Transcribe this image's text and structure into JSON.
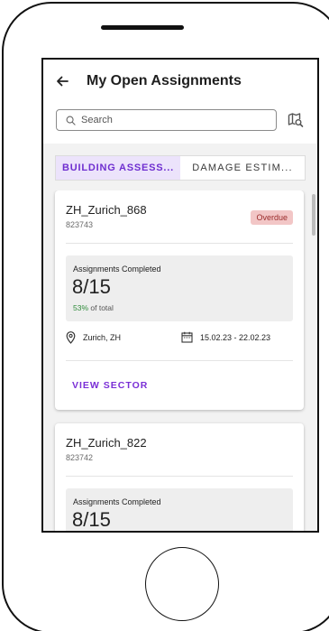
{
  "header": {
    "back_icon": "arrow-left-icon",
    "title": "My Open Assignments"
  },
  "search": {
    "placeholder": "Search",
    "icon": "search-icon",
    "map_icon": "map-search-icon"
  },
  "tabs": [
    {
      "label": "BUILDING ASSESS...",
      "active": true
    },
    {
      "label": "DAMAGE ESTIM...",
      "active": false
    }
  ],
  "cards": [
    {
      "title": "ZH_Zurich_868",
      "id": "823743",
      "status": "Overdue",
      "stats_label": "Assignments Completed",
      "stats_value": "8/15",
      "percent": "53%",
      "percent_suffix": " of total",
      "location": "Zurich, ZH",
      "dates": "15.02.23 - 22.02.23",
      "action": "VIEW SECTOR"
    },
    {
      "title": "ZH_Zurich_822",
      "id": "823742",
      "stats_label": "Assignments Completed",
      "stats_value": "8/15"
    }
  ],
  "colors": {
    "accent": "#7a2fd6",
    "active_tab_bg": "#ece3fb",
    "overdue_bg": "#f2c6c6",
    "percent_green": "#2e8b3a"
  }
}
